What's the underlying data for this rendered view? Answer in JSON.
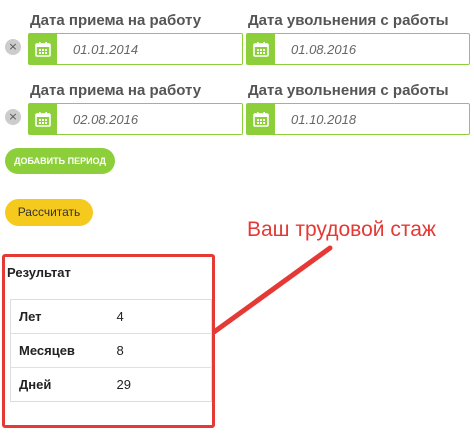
{
  "periods": [
    {
      "start_label": "Дата приема на работу",
      "start_value": "01.01.2014",
      "end_label": "Дата увольнения с работы",
      "end_value": "01.08.2016",
      "remove_glyph": "×"
    },
    {
      "start_label": "Дата приема на работу",
      "start_value": "02.08.2016",
      "end_label": "Дата увольнения с работы",
      "end_value": "01.10.2018",
      "remove_glyph": "×"
    }
  ],
  "buttons": {
    "add_period": "ДОБАВИТЬ ПЕРИОД",
    "calculate": "Рассчитать"
  },
  "annotation": {
    "text": "Ваш трудовой стаж",
    "color": "#e53935"
  },
  "result": {
    "title": "Результат",
    "rows": [
      {
        "label": "Лет",
        "value": "4"
      },
      {
        "label": "Месяцев",
        "value": "8"
      },
      {
        "label": "Дней",
        "value": "29"
      }
    ]
  },
  "colors": {
    "accent_green": "#8ccf3a",
    "accent_yellow": "#f6c91d",
    "highlight_red": "#e53935"
  },
  "icons": {
    "calendar": "calendar-icon",
    "remove": "close-icon"
  }
}
